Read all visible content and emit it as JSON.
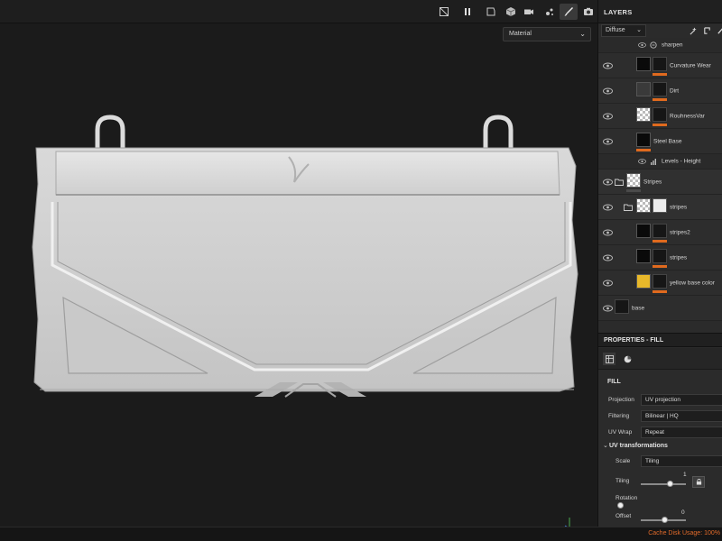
{
  "toolbar": {
    "icons": [
      "hide-icon",
      "pause-icon",
      "frame-icon",
      "cube-icon",
      "camera-icon",
      "stencil-icon",
      "brush-icon",
      "snapshot-icon"
    ],
    "active": "brush-icon"
  },
  "viewport": {
    "material_select": "Material",
    "chevron": "⌄"
  },
  "layers": {
    "title": "LAYERS",
    "channel_select": "Diffuse",
    "chevron": "⌄",
    "items": [
      {
        "name": "sharpen",
        "kind": "effect"
      },
      {
        "name": "Curvature Wear",
        "kind": "fill"
      },
      {
        "name": "Dirt",
        "kind": "fill"
      },
      {
        "name": "RouhnessVar",
        "kind": "fill"
      },
      {
        "name": "Steel Base",
        "kind": "fill"
      },
      {
        "name": "Levels - Height",
        "kind": "effect"
      },
      {
        "name": "Stripes",
        "kind": "group"
      },
      {
        "name": "stripes",
        "kind": "subgroup"
      },
      {
        "name": "stripes2",
        "kind": "fill"
      },
      {
        "name": "stripes",
        "kind": "fill"
      },
      {
        "name": "yellow base color",
        "kind": "fill"
      },
      {
        "name": "base",
        "kind": "paint"
      }
    ]
  },
  "properties": {
    "title": "PROPERTIES - FILL",
    "section": "FILL",
    "projection_label": "Projection",
    "projection_value": "UV projection",
    "filtering_label": "Filtering",
    "filtering_value": "Bilinear | HQ",
    "uvwrap_label": "UV Wrap",
    "uvwrap_value": "Repeat",
    "uv_section": "UV transformations",
    "uv_chevron": "⌄",
    "scale_label": "Scale",
    "scale_value": "Tiling",
    "tiling_label": "Tiling",
    "tiling_value": "1",
    "rotation_label": "Rotation",
    "offset_label": "Offset",
    "offset_value": "0"
  },
  "status": {
    "cache": "Cache Disk Usage: 100%"
  },
  "colors": {
    "accent_orange": "#e06a1e",
    "panel": "#2b2b2b",
    "viewport": "#1b1b1b"
  }
}
